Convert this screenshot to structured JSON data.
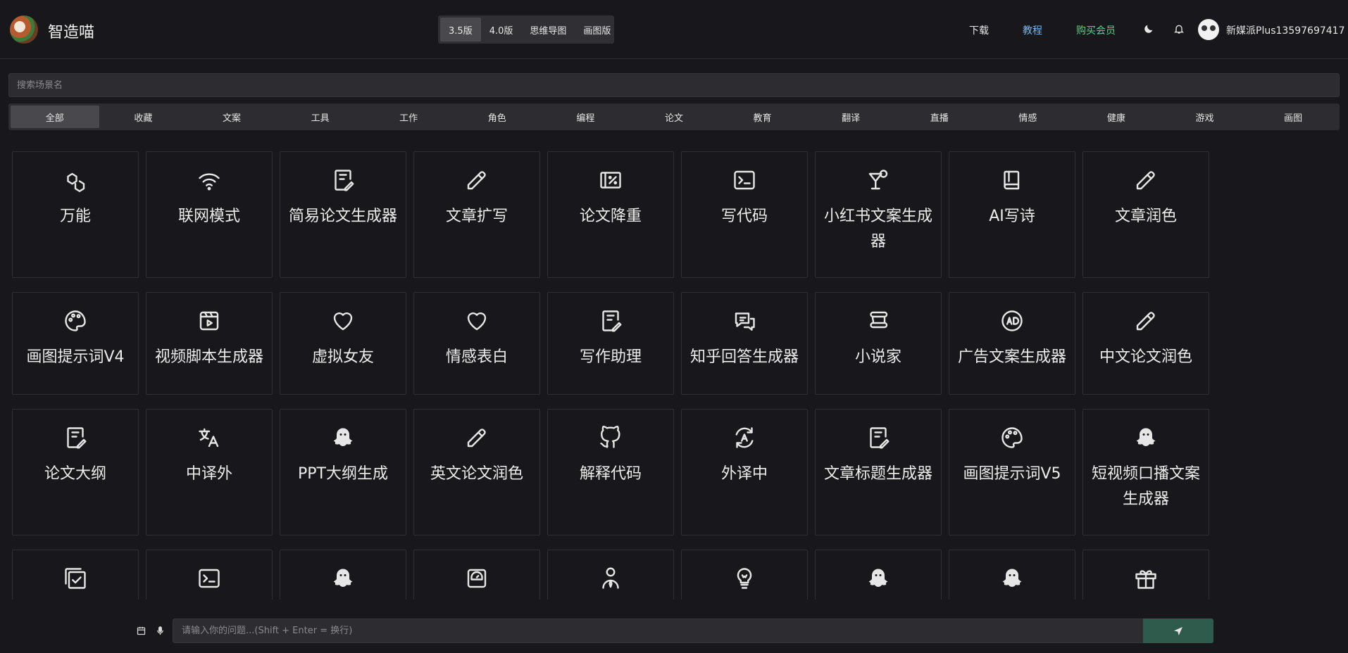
{
  "app": {
    "title": "智造喵"
  },
  "version_tabs": [
    {
      "label": "3.5版",
      "active": true
    },
    {
      "label": "4.0版",
      "active": false
    },
    {
      "label": "思维导图",
      "active": false
    },
    {
      "label": "画图版",
      "active": false
    }
  ],
  "nav": {
    "download": "下载",
    "tutorial": "教程",
    "buy_vip": "购买会员"
  },
  "colors": {
    "tutorial": "#7cb8f0",
    "buy_vip": "#5fd08a",
    "accent_send": "#2f5b4c",
    "background": "#18181c"
  },
  "user": {
    "name": "新媒派Plus13597697417"
  },
  "search": {
    "placeholder": "搜索场景名"
  },
  "categories": [
    "全部",
    "收藏",
    "文案",
    "工具",
    "工作",
    "角色",
    "编程",
    "论文",
    "教育",
    "翻译",
    "直播",
    "情感",
    "健康",
    "游戏",
    "画图"
  ],
  "active_category": "全部",
  "cards": [
    {
      "label": "万能",
      "icon": "hexagons-icon"
    },
    {
      "label": "联网模式",
      "icon": "wifi-icon"
    },
    {
      "label": "简易论文生成器",
      "icon": "document-edit-icon"
    },
    {
      "label": "文章扩写",
      "icon": "pencil-icon"
    },
    {
      "label": "论文降重",
      "icon": "percent-box-icon"
    },
    {
      "label": "写代码",
      "icon": "terminal-icon"
    },
    {
      "label": "小红书文案生成器",
      "icon": "cocktail-icon"
    },
    {
      "label": "AI写诗",
      "icon": "book-icon"
    },
    {
      "label": "文章润色",
      "icon": "pencil-icon"
    },
    {
      "label": "画图提示词V4",
      "icon": "palette-icon"
    },
    {
      "label": "视频脚本生成器",
      "icon": "video-icon"
    },
    {
      "label": "虚拟女友",
      "icon": "heart-icon"
    },
    {
      "label": "情感表白",
      "icon": "heart-icon"
    },
    {
      "label": "写作助理",
      "icon": "document-edit-icon"
    },
    {
      "label": "知乎回答生成器",
      "icon": "chat-bubbles-icon"
    },
    {
      "label": "小说家",
      "icon": "scroll-icon"
    },
    {
      "label": "广告文案生成器",
      "icon": "ad-icon"
    },
    {
      "label": "中文论文润色",
      "icon": "pencil-icon"
    },
    {
      "label": "论文大纲",
      "icon": "document-edit-icon"
    },
    {
      "label": "中译外",
      "icon": "translate-icon"
    },
    {
      "label": "PPT大纲生成",
      "icon": "ghost-icon"
    },
    {
      "label": "英文论文润色",
      "icon": "pencil-icon"
    },
    {
      "label": "解释代码",
      "icon": "github-icon"
    },
    {
      "label": "外译中",
      "icon": "language-cycle-icon"
    },
    {
      "label": "文章标题生成器",
      "icon": "document-edit-icon"
    },
    {
      "label": "画图提示词V5",
      "icon": "palette-icon"
    },
    {
      "label": "短视频口播文案生成器",
      "icon": "ghost-icon"
    },
    {
      "label": "",
      "icon": "checkbox-multiple-icon"
    },
    {
      "label": "",
      "icon": "terminal-icon"
    },
    {
      "label": "",
      "icon": "ghost-icon"
    },
    {
      "label": "",
      "icon": "scale-icon"
    },
    {
      "label": "",
      "icon": "person-tie-icon"
    },
    {
      "label": "",
      "icon": "lightbulb-icon"
    },
    {
      "label": "",
      "icon": "ghost-icon"
    },
    {
      "label": "",
      "icon": "ghost-icon"
    },
    {
      "label": "",
      "icon": "gift-icon"
    }
  ],
  "chat": {
    "placeholder": "请输入你的问题...(Shift + Enter = 换行)"
  }
}
